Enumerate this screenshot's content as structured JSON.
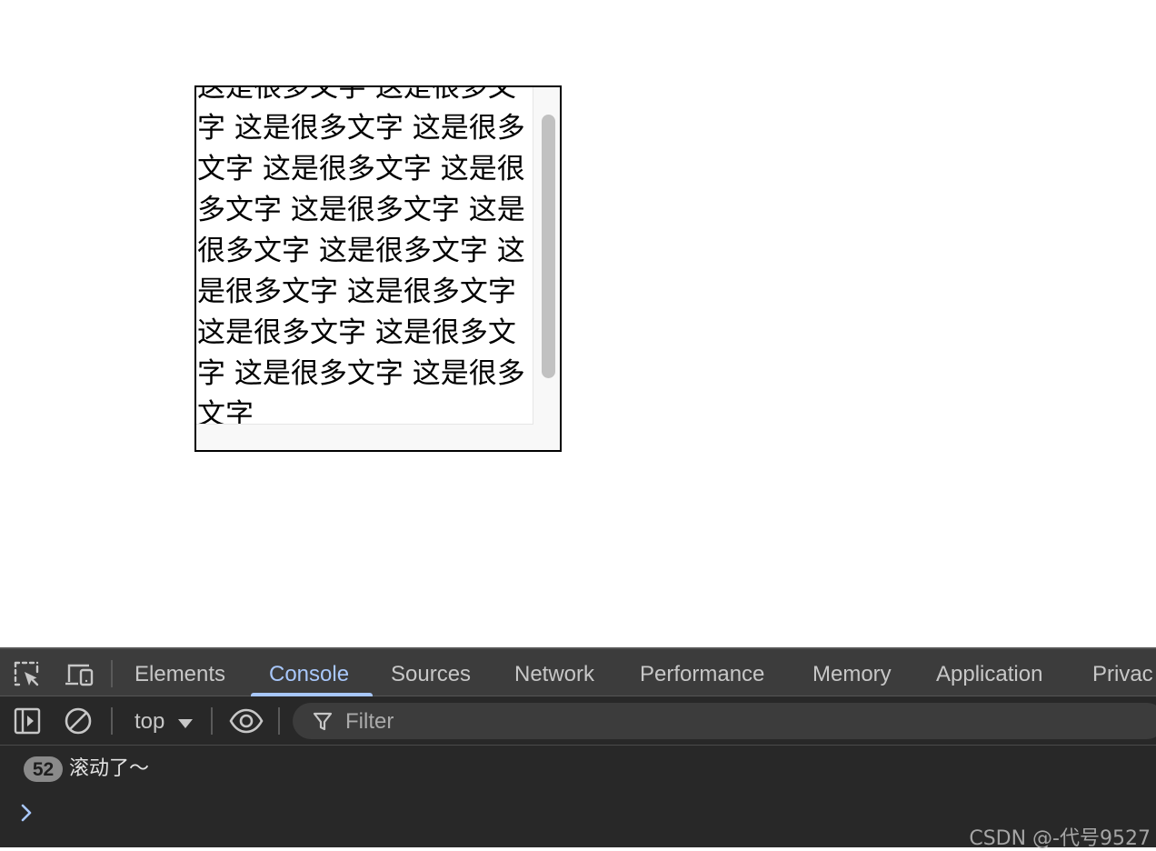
{
  "page": {
    "scroll_text": "这是很多文字 这是很多文字 这是很多文字 这是很多文字 这是很多文字 这是很多文字 这是很多文字 这是很多文字 这是很多文字 这是很多文字 这是很多文字 这是很多文字 这是很多文字 这是很多文字 这是很多文字"
  },
  "devtools": {
    "tabs": [
      {
        "label": "Elements"
      },
      {
        "label": "Console"
      },
      {
        "label": "Sources"
      },
      {
        "label": "Network"
      },
      {
        "label": "Performance"
      },
      {
        "label": "Memory"
      },
      {
        "label": "Application"
      },
      {
        "label": "Privac"
      }
    ],
    "active_tab": "Console",
    "context": "top",
    "filter_placeholder": "Filter",
    "log": {
      "count": "52",
      "message": "滚动了～"
    },
    "accent_color": "#a8c7fa"
  },
  "watermark": "CSDN @-代号9527"
}
